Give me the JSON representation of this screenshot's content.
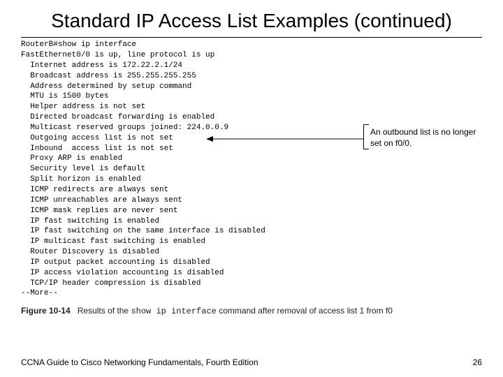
{
  "title": "Standard IP Access List Examples (continued)",
  "console_prompt": "RouterB#",
  "console_command": "show ip interface",
  "console_lines": [
    "FastEthernet0/0 is up, line protocol is up",
    "  Internet address is 172.22.2.1/24",
    "  Broadcast address is 255.255.255.255",
    "  Address determined by setup command",
    "  MTU is 1500 bytes",
    "  Helper address is not set",
    "  Directed broadcast forwarding is enabled",
    "  Multicast reserved groups joined: 224.0.0.9",
    "  Outgoing access list is not set",
    "  Inbound  access list is not set",
    "  Proxy ARP is enabled",
    "  Security level is default",
    "  Split horizon is enabled",
    "  ICMP redirects are always sent",
    "  ICMP unreachables are always sent",
    "  ICMP mask replies are never sent",
    "  IP fast switching is enabled",
    "  IP fast switching on the same interface is disabled",
    "  IP multicast fast switching is enabled",
    "  Router Discovery is disabled",
    "  IP output packet accounting is disabled",
    "  IP access violation accounting is disabled",
    "  TCP/IP header compression is disabled",
    "--More--"
  ],
  "callout_text": "An outbound list is no longer set on f0/0.",
  "figure": {
    "label": "Figure 10-14",
    "caption_prefix": "Results of the ",
    "caption_command": "show ip interface",
    "caption_suffix": " command after removal of access list 1 from f0"
  },
  "footer": {
    "book": "CCNA Guide to Cisco Networking Fundamentals, Fourth Edition",
    "page": "26"
  }
}
